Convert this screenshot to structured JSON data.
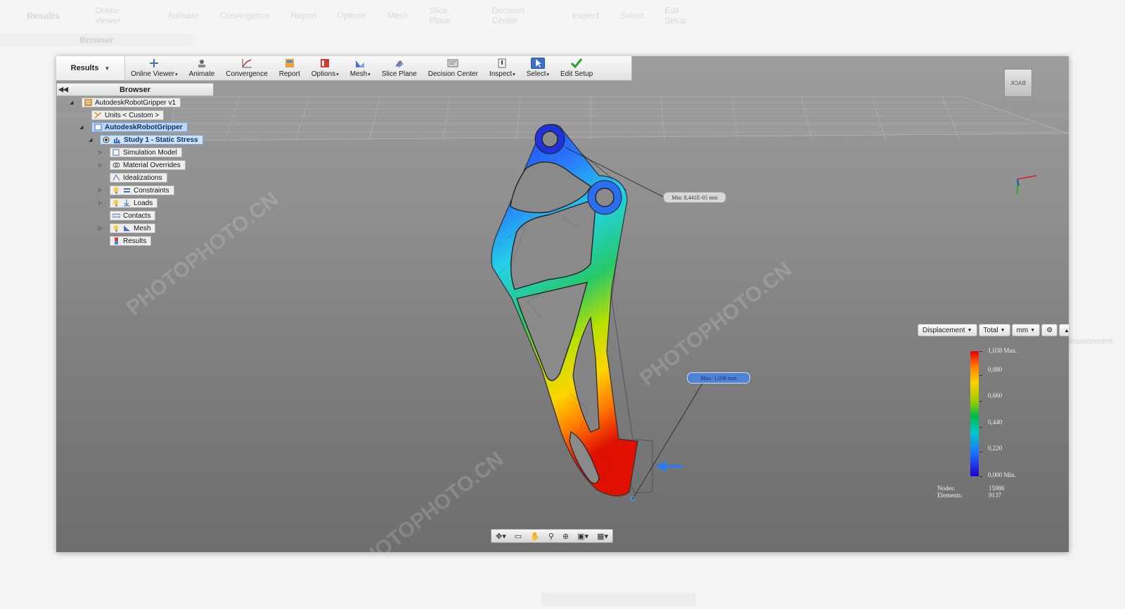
{
  "ghost": {
    "results": "Results",
    "items": [
      "Online Viewer",
      "Animate",
      "Convergence",
      "Report",
      "Options",
      "Mesh",
      "Slice Plane",
      "Decision Center",
      "Inspect",
      "Select",
      "Edit Setup"
    ],
    "browser": "Browser",
    "displacement": "Displacement"
  },
  "ribbon": {
    "tab": "Results",
    "buttons": [
      {
        "label": "Online Viewer",
        "icon": "online-viewer-icon",
        "dropdown": true
      },
      {
        "label": "Animate",
        "icon": "animate-icon",
        "dropdown": false
      },
      {
        "label": "Convergence",
        "icon": "convergence-icon",
        "dropdown": false
      },
      {
        "label": "Report",
        "icon": "report-icon",
        "dropdown": false
      },
      {
        "label": "Options",
        "icon": "options-icon",
        "dropdown": true
      },
      {
        "label": "Mesh",
        "icon": "mesh-icon",
        "dropdown": true
      },
      {
        "label": "Slice Plane",
        "icon": "slice-plane-icon",
        "dropdown": false
      },
      {
        "label": "Decision Center",
        "icon": "decision-center-icon",
        "dropdown": false
      },
      {
        "label": "Inspect",
        "icon": "inspect-icon",
        "dropdown": true
      },
      {
        "label": "Select",
        "icon": "select-cursor-icon",
        "dropdown": true
      },
      {
        "label": "Edit Setup",
        "icon": "checkmark-icon",
        "dropdown": false
      }
    ]
  },
  "browser": {
    "title": "Browser",
    "tree": [
      {
        "label": "AutodeskRobotGripper v1",
        "icon": "assembly-icon"
      },
      {
        "label": "Units < Custom >",
        "icon": "units-icon"
      },
      {
        "label": "AutodeskRobotGripper",
        "icon": "component-icon"
      },
      {
        "label": "Study 1 - Static Stress",
        "icon": "study-icon"
      },
      {
        "label": "Simulation Model",
        "icon": "simulation-model-icon"
      },
      {
        "label": "Material Overrides",
        "icon": "material-icon"
      },
      {
        "label": "Idealizations",
        "icon": "idealization-icon"
      },
      {
        "label": "Constraints",
        "icon": "constraint-icon"
      },
      {
        "label": "Loads",
        "icon": "load-icon"
      },
      {
        "label": "Contacts",
        "icon": "contact-icon"
      },
      {
        "label": "Mesh",
        "icon": "mesh-icon"
      },
      {
        "label": "Results",
        "icon": "results-icon"
      }
    ]
  },
  "probes": {
    "min": "Min: 8,441E-05 mm",
    "max": "Max: 1,038 mm"
  },
  "legend": {
    "result": "Displacement",
    "component": "Total",
    "unit": "mm",
    "labels": [
      "1,038 Max.",
      "0,880",
      "0,660",
      "0,440",
      "0,220",
      "0,000 Min."
    ],
    "nodes_label": "Nodes:",
    "nodes_value": "15986",
    "elements_label": "Elements:",
    "elements_value": "9137"
  },
  "viewcube": "BACK",
  "watermark": "PHOTOPHOTO.CN",
  "colors": {
    "selection": "#bcd6f5",
    "ribbon_active": "#3d6fc6",
    "load_arrow": "#2f7be8"
  }
}
